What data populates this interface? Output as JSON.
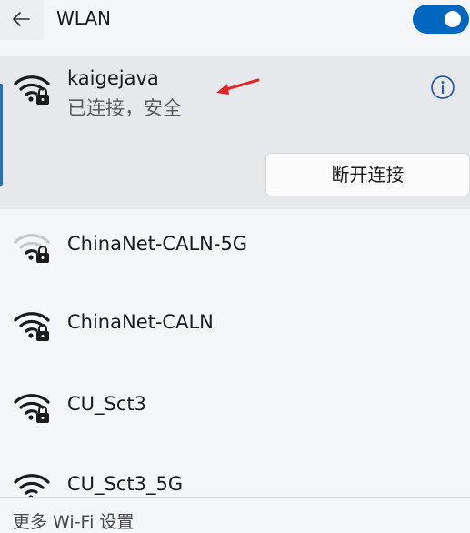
{
  "header": {
    "title": "WLAN",
    "back_icon": "arrow-left-icon",
    "wifi_enabled": true
  },
  "connected": {
    "name": "kaigejava",
    "status": "已连接，安全",
    "disconnect_label": "断开连接",
    "info_icon": "info-icon",
    "signal": "strong",
    "secured": true
  },
  "networks": [
    {
      "name": "ChinaNet-CALN-5G",
      "signal": "weak",
      "secured": true
    },
    {
      "name": "ChinaNet-CALN",
      "signal": "strong",
      "secured": true
    },
    {
      "name": "CU_Sct3",
      "signal": "strong",
      "secured": true
    },
    {
      "name": "CU_Sct3_5G",
      "signal": "strong",
      "secured": true
    }
  ],
  "footer": {
    "label": "更多 Wi-Fi 设置"
  },
  "colors": {
    "accent": "#0067c0",
    "annotation_arrow": "#e0242a",
    "panel_bg": "#e6e8eb",
    "page_bg": "#f4f6f9"
  }
}
